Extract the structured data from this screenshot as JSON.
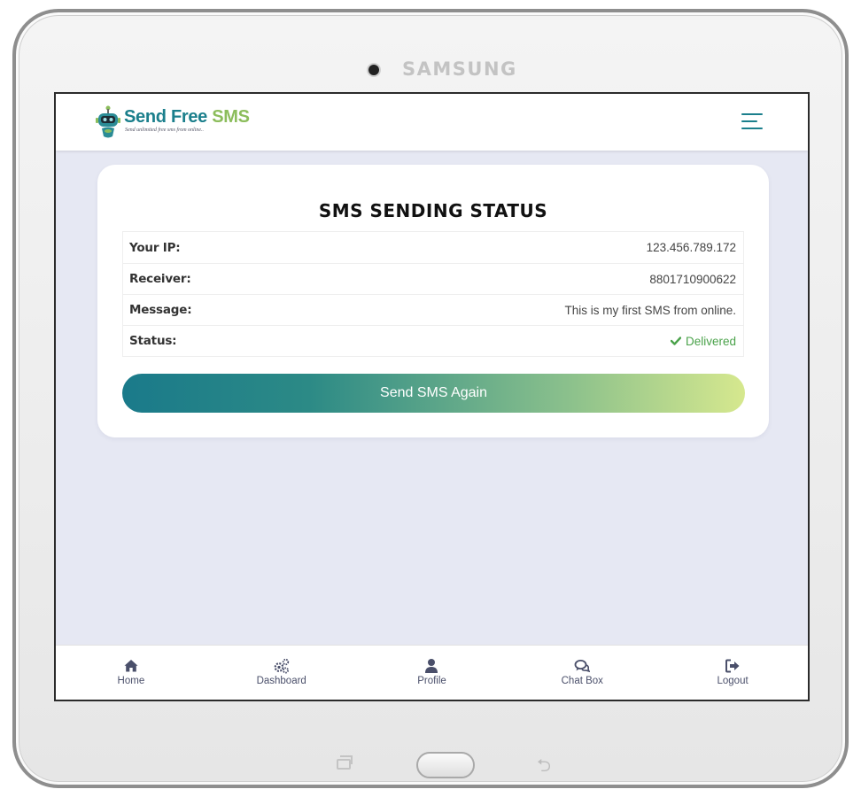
{
  "device": {
    "brand": "SAMSUNG"
  },
  "header": {
    "logo_title_main": "Send Free",
    "logo_title_accent": "SMS",
    "logo_tagline": "Send unlimited free sms from online..",
    "menu_icon": "hamburger-menu-icon"
  },
  "status_card": {
    "title": "SMS SENDING STATUS",
    "rows": [
      {
        "label": "Your IP:",
        "value": "123.456.789.172"
      },
      {
        "label": "Receiver:",
        "value": "8801710900622"
      },
      {
        "label": "Message:",
        "value": "This is my first SMS from online."
      },
      {
        "label": "Status:",
        "value": "Delivered",
        "icon": "check-icon"
      }
    ],
    "button_label": "Send SMS Again"
  },
  "bottom_nav": {
    "items": [
      {
        "label": "Home",
        "icon": "home-icon"
      },
      {
        "label": "Dashboard",
        "icon": "gears-icon"
      },
      {
        "label": "Profile",
        "icon": "user-icon"
      },
      {
        "label": "Chat Box",
        "icon": "chat-icon"
      },
      {
        "label": "Logout",
        "icon": "logout-icon"
      }
    ]
  },
  "colors": {
    "brand_teal": "#1b7f8c",
    "brand_green": "#8cbd5c",
    "status_delivered": "#4aa24a",
    "screen_background": "#e6e8f3",
    "nav_text": "#4a4f6a"
  }
}
